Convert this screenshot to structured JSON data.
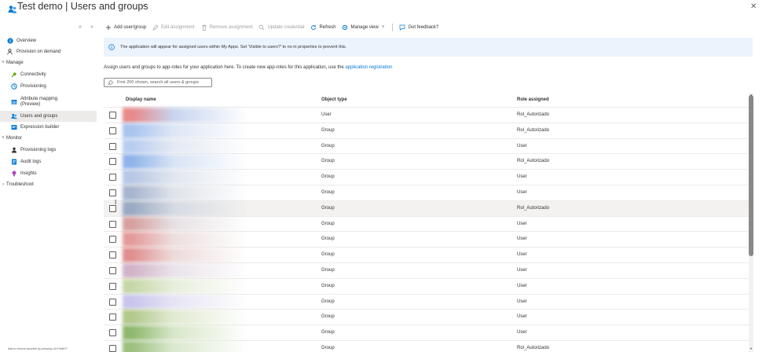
{
  "header": {
    "title": "Test demo | Users and groups",
    "more": "···",
    "close": "✕"
  },
  "sidebar": {
    "controls": [
      "»",
      "«"
    ],
    "items": [
      {
        "label": "Overview",
        "icon": "info-icon",
        "level": 0,
        "chevron": ""
      },
      {
        "label": "Provision on demand",
        "icon": "person-icon",
        "level": 0,
        "chevron": ""
      },
      {
        "label": "Manage",
        "icon": "",
        "level": 0,
        "chevron": "v"
      },
      {
        "label": "Connectivity",
        "icon": "plug-icon",
        "level": 1,
        "chevron": ""
      },
      {
        "label": "Provisioning",
        "icon": "provisioning-icon",
        "level": 1,
        "chevron": ""
      },
      {
        "label": "Attribute mapping (Preview)",
        "icon": "mapping-icon",
        "level": 1,
        "chevron": ""
      },
      {
        "label": "Users and groups",
        "icon": "users-icon",
        "level": 1,
        "chevron": "",
        "active": true
      },
      {
        "label": "Expression builder",
        "icon": "builder-icon",
        "level": 1,
        "chevron": ""
      },
      {
        "label": "Monitor",
        "icon": "",
        "level": 0,
        "chevron": "v"
      },
      {
        "label": "Provisioning logs",
        "icon": "person-icon",
        "level": 1,
        "chevron": ""
      },
      {
        "label": "Audit logs",
        "icon": "log-icon",
        "level": 1,
        "chevron": ""
      },
      {
        "label": "Insights",
        "icon": "bulb-icon",
        "level": 1,
        "chevron": ""
      },
      {
        "label": "Troubleshoot",
        "icon": "",
        "level": 0,
        "chevron": ">"
      }
    ],
    "footer": "Add or remove favorites by pressing Ctrl+Shift+F"
  },
  "toolbar": {
    "add": "Add user/group",
    "edit": "Edit assignment",
    "remove": "Remove assignment",
    "update": "Update credential",
    "refresh": "Refresh",
    "manage_view": "Manage view",
    "feedback": "Got feedback?"
  },
  "banner": {
    "text": "The application will appear for assigned users within My Apps. Set 'Visible to users?' to no in properties to prevent this."
  },
  "description": {
    "text": "Assign users and groups to app-roles for your application here. To create new app-roles for this application, use the",
    "link": "application registration"
  },
  "search": {
    "placeholder": "First 200 shown, search all users & groups"
  },
  "grid": {
    "columns": {
      "display_name": "Display name",
      "object_type": "Object type",
      "role": "Role assigned"
    },
    "rows": [
      {
        "type": "User",
        "role": "Rol_Autorizado"
      },
      {
        "type": "Group",
        "role": "Rol_Autorizado"
      },
      {
        "type": "Group",
        "role": "User"
      },
      {
        "type": "Group",
        "role": "Rol_Autorizado"
      },
      {
        "type": "Group",
        "role": "User"
      },
      {
        "type": "Group",
        "role": "User"
      },
      {
        "type": "Group",
        "role": "Rol_Autorizado"
      },
      {
        "type": "Group",
        "role": "User"
      },
      {
        "type": "Group",
        "role": "User"
      },
      {
        "type": "Group",
        "role": "User"
      },
      {
        "type": "Group",
        "role": "User"
      },
      {
        "type": "Group",
        "role": "User"
      },
      {
        "type": "Group",
        "role": "User"
      },
      {
        "type": "Group",
        "role": "User"
      },
      {
        "type": "Group",
        "role": "User"
      },
      {
        "type": "Group",
        "role": "Rol_Autorizado"
      }
    ]
  },
  "colors": {
    "accent": "#0078d4",
    "banner_bg": "#ebf3fc",
    "selected_nav": "#edebe9"
  }
}
